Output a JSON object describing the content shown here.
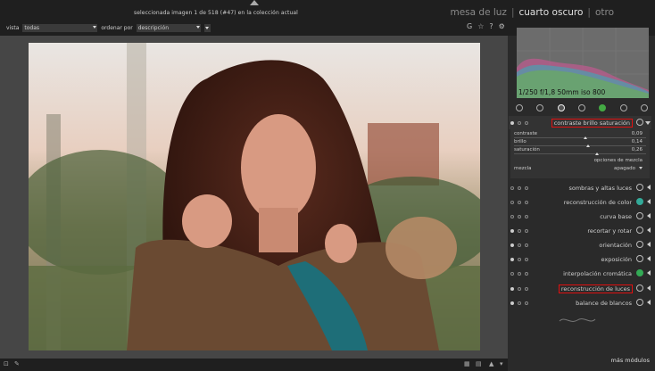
{
  "header": {
    "status": "seleccionada imagen 1 de 518 (#47) en la colección actual",
    "views": [
      {
        "label": "mesa de luz",
        "active": false
      },
      {
        "label": "cuarto oscuro",
        "active": true
      },
      {
        "label": "otro",
        "active": false
      }
    ],
    "separator": "|"
  },
  "filterbar": {
    "view_label": "vista",
    "view_value": "todas",
    "sort_label": "ordenar por",
    "sort_value": "descripción"
  },
  "top_icons": [
    "G",
    "☆",
    "?",
    "⚙"
  ],
  "histogram": {
    "info": "1/250 f/1,8 50mm iso 800"
  },
  "module_groups": [
    "power-icon",
    "star-icon",
    "circle-icon",
    "half-circle-icon",
    "color-icon",
    "drop-icon",
    "aperture-icon"
  ],
  "expanded_module": {
    "name": "contraste brillo saturación",
    "sliders": [
      {
        "label": "contraste",
        "value": "0,09",
        "fraction": 0.55
      },
      {
        "label": "brillo",
        "value": "0,14",
        "fraction": 0.57
      },
      {
        "label": "saturación",
        "value": "0,26",
        "fraction": 0.63
      }
    ],
    "blend_options": "opciones de mezcla",
    "blend_label": "mezcla",
    "blend_value": "apagado"
  },
  "modules": [
    {
      "name": "sombras y altas luces",
      "enabled": false
    },
    {
      "name": "reconstrucción de color",
      "enabled": false
    },
    {
      "name": "curva base",
      "enabled": false
    },
    {
      "name": "recortar y rotar",
      "enabled": true
    },
    {
      "name": "orientación",
      "enabled": true
    },
    {
      "name": "exposición",
      "enabled": true
    },
    {
      "name": "interpolación cromática",
      "enabled": false
    },
    {
      "name": "reconstrucción de luces",
      "enabled": true
    },
    {
      "name": "balance de blancos",
      "enabled": true
    }
  ],
  "more_modules": "más módulos"
}
